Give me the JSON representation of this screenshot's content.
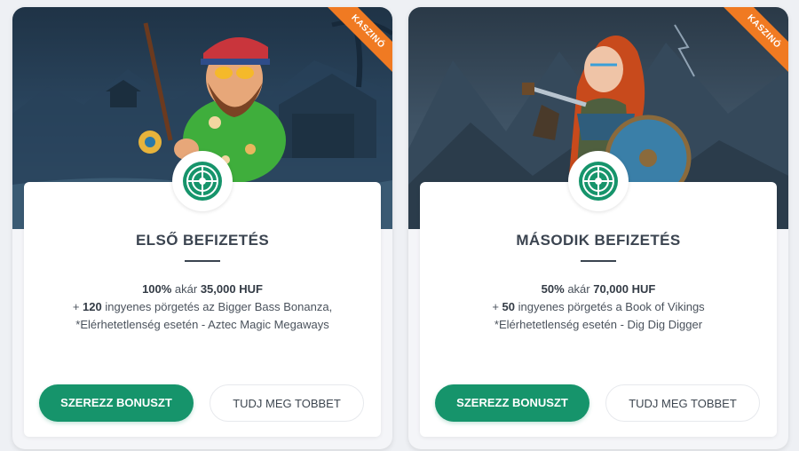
{
  "colors": {
    "accent_green": "#16946b",
    "ribbon_orange": "#f07a22",
    "text_dark": "#3b4450"
  },
  "cards": [
    {
      "ribbon": "KASZINÓ",
      "badge_icon": "roulette-icon",
      "title": "ELSŐ BEFIZETÉS",
      "offer": {
        "percent": "100%",
        "up_to_word": " akár ",
        "amount": "35,000 HUF",
        "spins_prefix": "+ ",
        "spins_count": "120",
        "spins_text": " ingyenes pörgetés az Bigger Bass Bonanza,",
        "fallback": "*Elérhetetlenség esetén - Aztec Magic Megaways"
      },
      "primary_button": "SZEREZZ BONUSZT",
      "secondary_button": "TUDJ MEG TOBBET"
    },
    {
      "ribbon": "KASZINÓ",
      "badge_icon": "roulette-icon",
      "title": "MÁSODIK BEFIZETÉS",
      "offer": {
        "percent": "50%",
        "up_to_word": " akár ",
        "amount": "70,000 HUF",
        "spins_prefix": "+ ",
        "spins_count": "50",
        "spins_text": " ingyenes pörgetés a Book of Vikings",
        "fallback": "*Elérhetetlenség esetén - Dig Dig Digger"
      },
      "primary_button": "SZEREZZ BONUSZT",
      "secondary_button": "TUDJ MEG TOBBET"
    }
  ]
}
